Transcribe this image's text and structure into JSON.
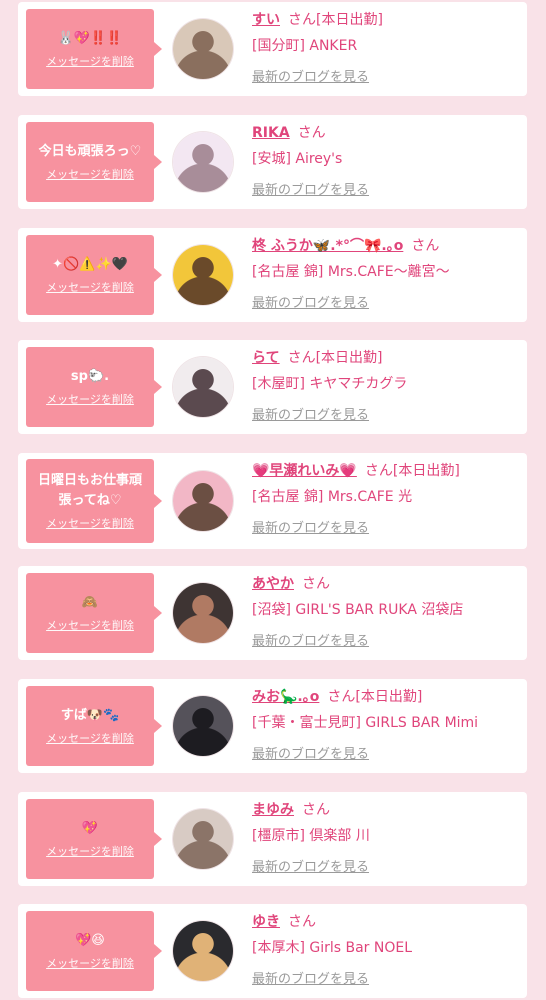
{
  "items": [
    {
      "message": "🐰💖‼️‼️",
      "delete_label": "メッセージを削除",
      "name": "すい",
      "suffix": "さん[本日出勤]",
      "shop": "[国分町] ANKER",
      "blog_label": "最新のブログを見る",
      "avatar_colors": [
        "#d9c8b8",
        "#8a6f5e"
      ]
    },
    {
      "message": "今日も頑張ろっ♡",
      "delete_label": "メッセージを削除",
      "name": "RIKA",
      "suffix": "さん",
      "shop": "[安城] Airey's",
      "blog_label": "最新のブログを見る",
      "avatar_colors": [
        "#f3e7f2",
        "#a88d99"
      ]
    },
    {
      "message": "✦🚫⚠️✨🖤",
      "delete_label": "メッセージを削除",
      "name": "柊 ふうか🦋.*°⌒🎀.｡o",
      "suffix": "さん",
      "shop": "[名古屋 錦] Mrs.CAFE〜離宮〜",
      "blog_label": "最新のブログを見る",
      "avatar_colors": [
        "#f2c63a",
        "#6a4a2a"
      ]
    },
    {
      "message": "sp🐑.",
      "delete_label": "メッセージを削除",
      "name": "らて",
      "suffix": "さん[本日出勤]",
      "shop": "[木屋町] キヤマチカグラ",
      "blog_label": "最新のブログを見る",
      "avatar_colors": [
        "#f1ecee",
        "#5b4a4f"
      ]
    },
    {
      "message": "日曜日もお仕事頑張ってね♡",
      "delete_label": "メッセージを削除",
      "name": "💗早瀬れいみ💗",
      "suffix": "さん[本日出勤]",
      "shop": "[名古屋 錦] Mrs.CAFE 光",
      "blog_label": "最新のブログを見る",
      "avatar_colors": [
        "#f2b7c6",
        "#6b4f43"
      ]
    },
    {
      "message": "🙈",
      "delete_label": "メッセージを削除",
      "name": "あやか",
      "suffix": "さん",
      "shop": "[沼袋] GIRL'S BAR RUKA 沼袋店",
      "blog_label": "最新のブログを見る",
      "avatar_colors": [
        "#3e3433",
        "#b07a63"
      ]
    },
    {
      "message": "すば🐶🐾",
      "delete_label": "メッセージを削除",
      "name": "みお🦕.｡o",
      "suffix": "さん[本日出勤]",
      "shop": "[千葉・富士見町] GIRLS BAR Mimi",
      "blog_label": "最新のブログを見る",
      "avatar_colors": [
        "#55525a",
        "#1d1c21"
      ]
    },
    {
      "message": "💖",
      "delete_label": "メッセージを削除",
      "name": "まゆみ",
      "suffix": "さん",
      "shop": "[橿原市] 倶楽部 川",
      "blog_label": "最新のブログを見る",
      "avatar_colors": [
        "#d8cbc4",
        "#8b7468"
      ]
    },
    {
      "message": "💖😆",
      "delete_label": "メッセージを削除",
      "name": "ゆき",
      "suffix": "さん",
      "shop": "[本厚木] Girls Bar NOEL",
      "blog_label": "最新のブログを見る",
      "avatar_colors": [
        "#2a2a2e",
        "#e0b277"
      ]
    }
  ]
}
